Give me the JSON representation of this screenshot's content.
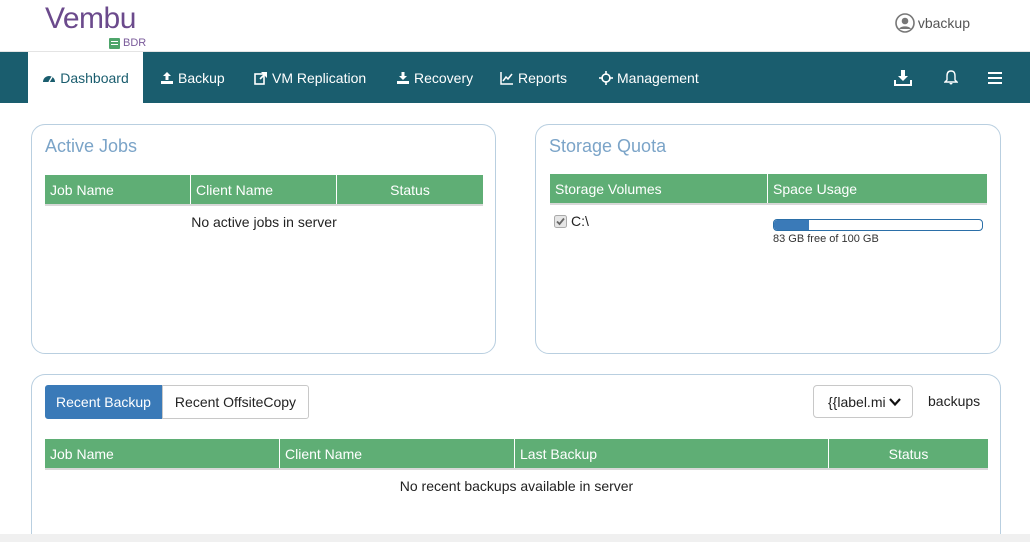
{
  "header": {
    "logo_text": "Vembu",
    "logo_sub": "BDR",
    "username": "vbackup"
  },
  "nav": {
    "items": [
      {
        "label": "Dashboard",
        "icon": "dashboard-icon",
        "active": true
      },
      {
        "label": "Backup",
        "icon": "upload-icon"
      },
      {
        "label": "VM Replication",
        "icon": "external-link-icon"
      },
      {
        "label": "Recovery",
        "icon": "download-icon"
      },
      {
        "label": "Reports",
        "icon": "line-chart-icon"
      },
      {
        "label": "Management",
        "icon": "crosshair-icon"
      }
    ],
    "right_icons": [
      "download-tray-icon",
      "bell-icon",
      "hamburger-menu-icon"
    ]
  },
  "active_jobs": {
    "title": "Active Jobs",
    "columns": [
      "Job Name",
      "Client Name",
      "Status"
    ],
    "empty_message": "No active jobs in server"
  },
  "storage_quota": {
    "title": "Storage Quota",
    "columns": [
      "Storage Volumes",
      "Space Usage"
    ],
    "volumes": [
      {
        "name": "C:\\",
        "checked": true,
        "used_fraction": 0.17,
        "usage_text": "83 GB free of 100 GB"
      }
    ]
  },
  "recent": {
    "tabs": [
      "Recent Backup",
      "Recent OffsiteCopy"
    ],
    "active_tab": 0,
    "select_value": "{{label.mi",
    "select_suffix": "backups",
    "columns": [
      "Job Name",
      "Client Name",
      "Last Backup",
      "Status"
    ],
    "empty_message": "No recent backups available in server"
  },
  "colors": {
    "nav_bg": "#1a5d6e",
    "grid_header": "#5fae75",
    "accent_blue": "#3a7ab8",
    "panel_title": "#7ba4c8",
    "brand_purple": "#6b4a8c"
  }
}
